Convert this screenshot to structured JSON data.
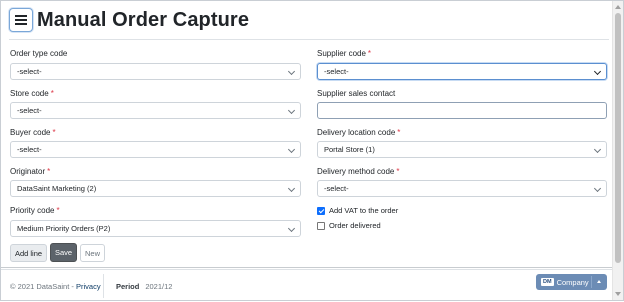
{
  "page": {
    "title": "Manual Order Capture"
  },
  "left_fields": [
    {
      "label": "Order type code",
      "required": false,
      "value": "-select-"
    },
    {
      "label": "Store code",
      "required": true,
      "value": "-select-"
    },
    {
      "label": "Buyer code",
      "required": true,
      "value": "-select-"
    },
    {
      "label": "Originator",
      "required": true,
      "value": "DataSaint Marketing (2)"
    },
    {
      "label": "Priority code",
      "required": true,
      "value": "Medium Priority Orders (P2)"
    }
  ],
  "right_fields": {
    "supplier_code": {
      "label": "Supplier code",
      "required": true,
      "value": "-select-"
    },
    "supplier_sales_contact": {
      "label": "Supplier sales contact",
      "value": ""
    },
    "delivery_location_code": {
      "label": "Delivery location code",
      "required": true,
      "value": "Portal Store (1)"
    },
    "delivery_method_code": {
      "label": "Delivery method code",
      "required": true,
      "value": "-select-"
    }
  },
  "checkboxes": {
    "add_vat": {
      "label": "Add VAT to the order",
      "checked": true
    },
    "order_delivered": {
      "label": "Order delivered",
      "checked": false
    }
  },
  "buttons": {
    "add_line": "Add line",
    "save": "Save",
    "new": "New"
  },
  "footer": {
    "copyright": "© 2021 DataSaint -",
    "privacy": "Privacy",
    "period_label": "Period",
    "period_value": "2021/12",
    "company_badge": "DM",
    "company_label": "Company"
  },
  "colors": {
    "required": "#dc3545",
    "save_button": "#5c636a",
    "company_button": "#6c8cb5",
    "checkbox_checked": "#0d6efd"
  }
}
